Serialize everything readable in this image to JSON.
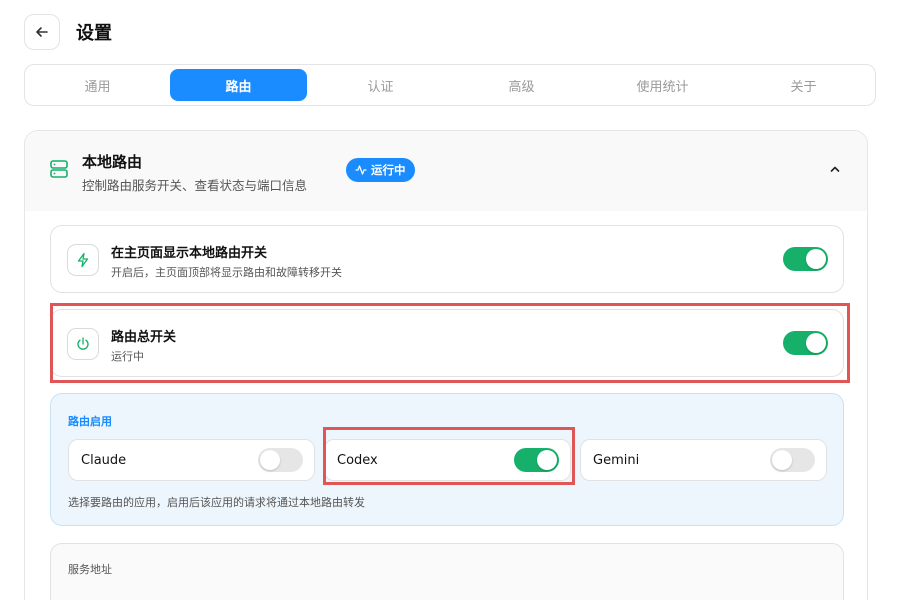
{
  "header": {
    "title": "设置",
    "back_icon": "arrow-left-icon"
  },
  "tabs": [
    {
      "label": "通用",
      "active": false
    },
    {
      "label": "路由",
      "active": true
    },
    {
      "label": "认证",
      "active": false
    },
    {
      "label": "高级",
      "active": false
    },
    {
      "label": "使用统计",
      "active": false
    },
    {
      "label": "关于",
      "active": false
    }
  ],
  "local_routing": {
    "icon": "server-icon",
    "title": "本地路由",
    "subtitle": "控制路由服务开关、查看状态与端口信息",
    "status_icon": "activity-icon",
    "status": "运行中",
    "expanded": true
  },
  "settings": [
    {
      "icon": "bolt-icon",
      "title": "在主页面显示本地路由开关",
      "desc": "开启后，主页面顶部将显示路由和故障转移开关",
      "enabled": true
    },
    {
      "icon": "power-icon",
      "title": "路由总开关",
      "desc": "运行中",
      "enabled": true
    }
  ],
  "routing_enabled": {
    "title": "路由启用",
    "apps": [
      {
        "name": "Claude",
        "enabled": false
      },
      {
        "name": "Codex",
        "enabled": true
      },
      {
        "name": "Gemini",
        "enabled": false
      }
    ],
    "description": "选择要路由的应用，启用后该应用的请求将通过本地路由转发"
  },
  "service_address": {
    "label": "服务地址"
  },
  "colors": {
    "accent": "#1a8cff",
    "toggle_on": "#16b06b",
    "toggle_off": "#e6e6e6",
    "highlight": "#e05555"
  }
}
